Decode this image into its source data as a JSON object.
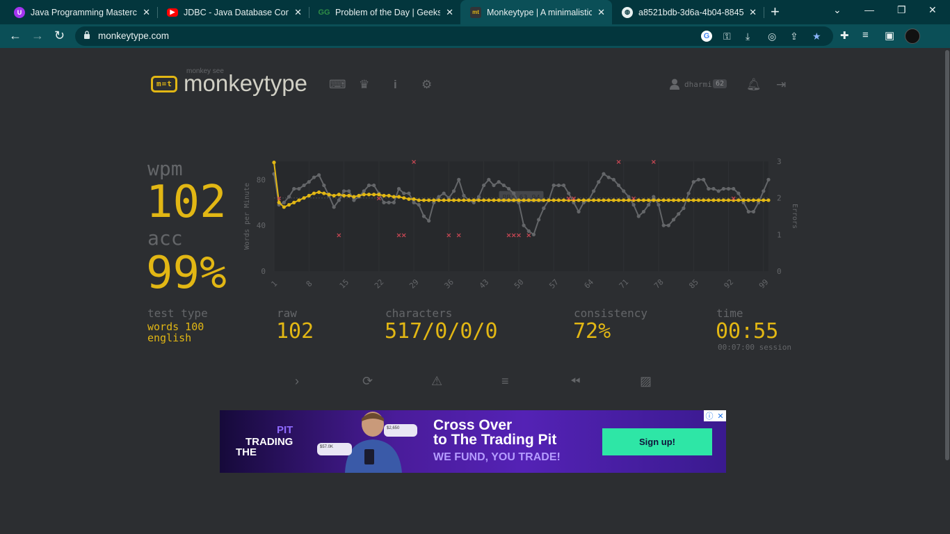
{
  "browser": {
    "tabs": [
      {
        "title": "Java Programming Masterclass",
        "icon": "udemy-icon",
        "color": "#a435f0"
      },
      {
        "title": "JDBC - Java Database Connectivity",
        "icon": "youtube-icon",
        "color": "#ff0000"
      },
      {
        "title": "Problem of the Day | GeeksforGeeks",
        "icon": "geeksforgeeks-icon",
        "color": "#2f8d46"
      },
      {
        "title": "Monkeytype | A minimalistic typing test",
        "icon": "monkeytype-icon",
        "color": "#e2b714"
      },
      {
        "title": "a8521bdb-3d6a-4b04-8845-",
        "icon": "globe-icon",
        "color": "#e8f0f0"
      }
    ],
    "url": "monkeytype.com"
  },
  "header": {
    "logo_small": "monkey see",
    "logo_text": "monkeytype",
    "logo_mark": "m=t",
    "username": "dharmi",
    "level": "62"
  },
  "stats": {
    "wpm_label": "wpm",
    "wpm": "102",
    "acc_label": "acc",
    "acc": "99%",
    "test_type_label": "test type",
    "test_type_line1": "words 100",
    "test_type_line2": "english",
    "raw_label": "raw",
    "raw": "102",
    "characters_label": "characters",
    "characters": "517/0/0/0",
    "consistency_label": "consistency",
    "consistency": "72%",
    "time_label": "time",
    "time": "00:55",
    "session": "00:07:00 session"
  },
  "ad": {
    "pit": "PIT",
    "trading": "TRADING",
    "the": "THE",
    "headline1": "Cross Over",
    "headline2": "to The Trading Pit",
    "subline": "WE FUND, YOU TRADE!",
    "cta": "Sign up!",
    "chip1": "$2,650",
    "chip2": "$57.0K"
  },
  "chart_data": {
    "type": "line",
    "ylabel": "Words per Minute",
    "ylabel_right": "Errors",
    "ylim": [
      0,
      96
    ],
    "ylim_right": [
      0,
      3
    ],
    "yticks": [
      0,
      40,
      80
    ],
    "yticks_right": [
      0,
      1,
      2,
      3
    ],
    "xticks": [
      1,
      8,
      15,
      22,
      29,
      36,
      43,
      50,
      57,
      64,
      71,
      78,
      85,
      92,
      99
    ],
    "annotation": "PB: 63.94",
    "pb": 63.94,
    "series": [
      {
        "name": "wpm",
        "color": "#e2b714",
        "values": [
          95,
          60,
          56,
          58,
          60,
          62,
          64,
          66,
          68,
          69,
          68,
          67,
          66,
          67,
          66,
          66,
          65,
          66,
          67,
          67,
          67,
          67,
          66,
          66,
          65,
          65,
          64,
          63,
          63,
          62,
          62,
          62,
          62,
          62,
          62,
          62,
          62,
          62,
          62,
          62,
          62,
          62,
          62,
          62,
          62,
          62,
          62,
          62,
          62,
          62,
          62,
          62,
          62,
          62,
          62,
          62,
          62,
          62,
          62,
          62,
          62,
          62,
          62,
          62,
          62,
          62,
          62,
          62,
          62,
          62,
          62,
          62,
          62,
          62,
          62,
          62,
          62,
          62,
          62,
          62,
          62,
          62,
          62,
          62,
          62,
          62,
          62,
          62,
          62,
          62,
          62,
          62,
          62,
          62,
          62,
          62,
          62,
          62,
          62,
          62
        ]
      },
      {
        "name": "raw",
        "color": "#646669",
        "values": [
          85,
          58,
          60,
          65,
          72,
          72,
          75,
          78,
          82,
          84,
          75,
          66,
          56,
          62,
          70,
          70,
          62,
          65,
          70,
          75,
          75,
          68,
          60,
          60,
          60,
          72,
          68,
          68,
          60,
          58,
          48,
          44,
          60,
          65,
          68,
          64,
          70,
          80,
          66,
          62,
          60,
          65,
          75,
          80,
          75,
          78,
          75,
          72,
          68,
          60,
          40,
          35,
          32,
          45,
          55,
          62,
          75,
          75,
          75,
          68,
          60,
          52,
          60,
          62,
          70,
          78,
          85,
          82,
          80,
          75,
          70,
          65,
          58,
          48,
          52,
          58,
          65,
          58,
          40,
          40,
          45,
          50,
          55,
          68,
          78,
          80,
          80,
          72,
          72,
          70,
          72,
          72,
          72,
          68,
          60,
          52,
          52,
          60,
          70,
          80
        ]
      },
      {
        "name": "errors",
        "color": "#ca4754",
        "points": [
          [
            2,
            2
          ],
          [
            14,
            1
          ],
          [
            22,
            2
          ],
          [
            26,
            1
          ],
          [
            27,
            1
          ],
          [
            29,
            3
          ],
          [
            36,
            1
          ],
          [
            38,
            1
          ],
          [
            48,
            1
          ],
          [
            49,
            1
          ],
          [
            50,
            1
          ],
          [
            52,
            1
          ],
          [
            60,
            2
          ],
          [
            61,
            2
          ],
          [
            70,
            3
          ],
          [
            73,
            2
          ],
          [
            77,
            3
          ],
          [
            93,
            2
          ]
        ]
      }
    ]
  }
}
